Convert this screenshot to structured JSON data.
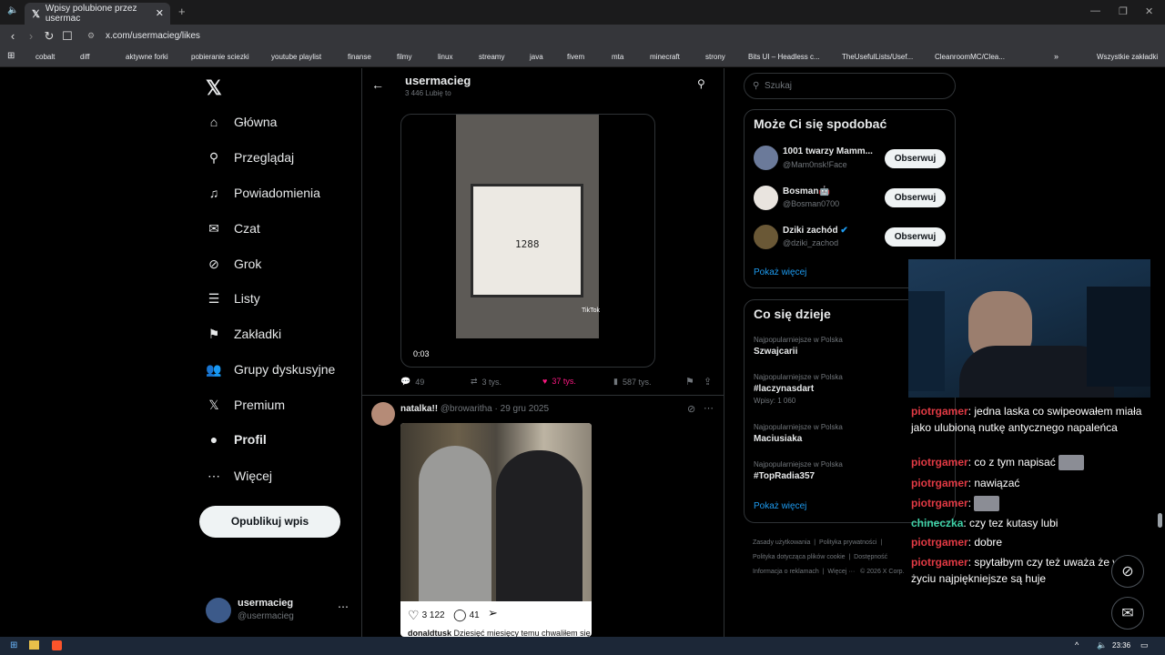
{
  "browser": {
    "tab_title": "Wpisy polubione przez usermac",
    "url": "x.com/usermacieg/likes",
    "bookmarks": [
      "cobalt",
      "diff",
      "aktywne forki",
      "pobieranie sciezki",
      "youtube playlist",
      "finanse",
      "filmy",
      "linux",
      "streamy",
      "java",
      "fivem",
      "mta",
      "minecraft",
      "strony",
      "Bits UI – Headless c...",
      "TheUsefulLists/Usef...",
      "CleanroomMC/Clea..."
    ],
    "all_bookmarks": "Wszystkie zakładki"
  },
  "sidebar": {
    "items": [
      {
        "label": "Główna",
        "icon": "home-icon"
      },
      {
        "label": "Przeglądaj",
        "icon": "search-icon"
      },
      {
        "label": "Powiadomienia",
        "icon": "bell-icon"
      },
      {
        "label": "Czat",
        "icon": "mail-icon"
      },
      {
        "label": "Grok",
        "icon": "grok-icon"
      },
      {
        "label": "Listy",
        "icon": "list-icon"
      },
      {
        "label": "Zakładki",
        "icon": "bookmark-icon"
      },
      {
        "label": "Grupy dyskusyjne",
        "icon": "people-icon"
      },
      {
        "label": "Premium",
        "icon": "x-icon"
      },
      {
        "label": "Profil",
        "icon": "person-icon"
      },
      {
        "label": "Więcej",
        "icon": "more-icon"
      }
    ],
    "publish": "Opublikuj wpis",
    "profile_name": "usermacieg",
    "profile_handle": "@usermacieg"
  },
  "profile_header": {
    "name": "usermacieg",
    "subtitle": "3 446 Lubię to"
  },
  "post1": {
    "video_number": "1288",
    "video_time": "0:03",
    "tiktok": "TikTok",
    "replies": "49",
    "reposts": "3 tys.",
    "likes": "37 tys.",
    "views": "587 tys."
  },
  "post2": {
    "name": "natalka!!",
    "handle": "@browaritha",
    "date": "29 gru 2025",
    "embed_likes": "3 122",
    "embed_comments": "41",
    "embed_caption_user": "donaldtusk",
    "embed_caption_text": "Dziesięć miesięcy temu chwaliłem się"
  },
  "right": {
    "search_placeholder": "Szukaj",
    "suggest_title": "Może Ci się spodobać",
    "suggestions": [
      {
        "name": "1001 twarzy Mamm...",
        "handle": "@Mam0nsk!Face",
        "btn": "Obserwuj"
      },
      {
        "name": "Bosman🤖",
        "handle": "@Bosman0700",
        "btn": "Obserwuj"
      },
      {
        "name": "Dziki zachód",
        "handle": "@dziki_zachod",
        "btn": "Obserwuj"
      }
    ],
    "show_more": "Pokaż więcej",
    "trends_title": "Co się dzieje",
    "trends": [
      {
        "cat": "Najpopularniejsze w Polska",
        "name": "Szwajcarii",
        "posts": ""
      },
      {
        "cat": "Najpopularniejsze w Polska",
        "name": "#laczynasdart",
        "posts": "Wpisy: 1 060"
      },
      {
        "cat": "Najpopularniejsze w Polska",
        "name": "Maciusiaka",
        "posts": ""
      },
      {
        "cat": "Najpopularniejsze w Polska",
        "name": "#TopRadia357",
        "posts": ""
      }
    ],
    "trends_more": "Pokaż więcej",
    "footer": [
      "Zasady użytkowania",
      "Polityka prywatności",
      "Polityka dotycząca plików cookie",
      "Dostępność",
      "Informacja o reklamach",
      "Więcej ···",
      "© 2026 X Corp."
    ]
  },
  "chat": [
    {
      "user": "piotrgamer",
      "text": ": jedna laska co swipeowałem miała jako ulubioną nutkę antycznego napaleńca"
    },
    {
      "user": "piotrgamer",
      "text": ": co z tym napisać"
    },
    {
      "user": "piotrgamer",
      "text": ": nawiązać"
    },
    {
      "user": "piotrgamer",
      "text": ":"
    },
    {
      "user": "chineczka",
      "text": ": czy tez kutasy lubi"
    },
    {
      "user": "piotrgamer",
      "text": ": dobre"
    },
    {
      "user": "piotrgamer",
      "text": ": spytałbym czy też uważa że w życiu najpiękniejsze są huje"
    }
  ],
  "taskbar": {
    "time": "23:36"
  }
}
